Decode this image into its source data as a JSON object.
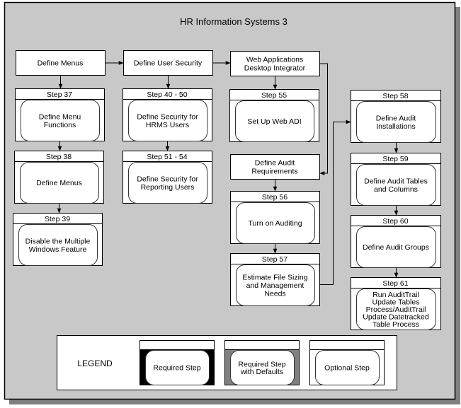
{
  "diagram": {
    "title": "HR Information Systems 3",
    "colors": {
      "background": "#c8c8c8",
      "shadow": "#808080",
      "box_fill": "#ffffff",
      "stroke": "#000000",
      "defaults_fill": "#808080"
    },
    "headers": [
      {
        "id": "define-menus",
        "lines": [
          "Define Menus"
        ]
      },
      {
        "id": "define-user-security",
        "lines": [
          "Define User Security"
        ]
      },
      {
        "id": "web-adi",
        "lines": [
          "Web Applications",
          "Desktop Integrator"
        ]
      },
      {
        "id": "define-audit-requirements",
        "lines": [
          "Define Audit",
          "Requirements"
        ]
      }
    ],
    "steps": [
      {
        "id": "step-37",
        "step": "Step 37",
        "lines": [
          "Define Menu",
          "Functions"
        ],
        "type": "optional"
      },
      {
        "id": "step-38",
        "step": "Step 38",
        "lines": [
          "Define Menus"
        ],
        "type": "optional"
      },
      {
        "id": "step-39",
        "step": "Step 39",
        "lines": [
          "Disable the Multiple",
          "Windows Feature"
        ],
        "type": "optional"
      },
      {
        "id": "step-40-50",
        "step": "Step 40 - 50",
        "lines": [
          "Define Security for",
          "HRMS Users"
        ],
        "type": "optional"
      },
      {
        "id": "step-51-54",
        "step": "Step 51 - 54",
        "lines": [
          "Define Security for",
          "Reporting Users"
        ],
        "type": "optional"
      },
      {
        "id": "step-55",
        "step": "Step 55",
        "lines": [
          "Set Up Web ADI"
        ],
        "type": "optional"
      },
      {
        "id": "step-56",
        "step": "Step 56",
        "lines": [
          "Turn on Auditing"
        ],
        "type": "optional"
      },
      {
        "id": "step-57",
        "step": "Step 57",
        "lines": [
          "Estimate File Sizing",
          "and Management",
          "Needs"
        ],
        "type": "optional"
      },
      {
        "id": "step-58",
        "step": "Step 58",
        "lines": [
          "Define Audit",
          "Installations"
        ],
        "type": "optional"
      },
      {
        "id": "step-59",
        "step": "Step 59",
        "lines": [
          "Define Audit Tables",
          "and Columns"
        ],
        "type": "optional"
      },
      {
        "id": "step-60",
        "step": "Step 60",
        "lines": [
          "Define Audit Groups"
        ],
        "type": "optional"
      },
      {
        "id": "step-61",
        "step": "Step 61",
        "lines": [
          "Run AuditTrail",
          "Update Tables",
          "Process/AuditTrail",
          "Update Datetracked",
          "Table Process"
        ],
        "type": "optional"
      }
    ],
    "edges": [
      {
        "from": "define-menus",
        "to": "define-user-security"
      },
      {
        "from": "define-user-security",
        "to": "web-adi"
      },
      {
        "from": "define-menus",
        "to": "step-37"
      },
      {
        "from": "step-37",
        "to": "step-38"
      },
      {
        "from": "step-38",
        "to": "step-39"
      },
      {
        "from": "define-user-security",
        "to": "step-40-50"
      },
      {
        "from": "step-40-50",
        "to": "step-51-54"
      },
      {
        "from": "web-adi",
        "to": "step-55"
      },
      {
        "from": "web-adi",
        "to": "define-audit-requirements"
      },
      {
        "from": "define-audit-requirements",
        "to": "step-56"
      },
      {
        "from": "step-56",
        "to": "step-57"
      },
      {
        "from": "step-57",
        "to": "step-58"
      },
      {
        "from": "step-58",
        "to": "step-59"
      },
      {
        "from": "step-59",
        "to": "step-60"
      },
      {
        "from": "step-60",
        "to": "step-61"
      }
    ],
    "legend": {
      "title": "LEGEND",
      "items": [
        {
          "type": "required",
          "lines": [
            "Required Step"
          ]
        },
        {
          "type": "defaults",
          "lines": [
            "Required Step",
            "with Defaults"
          ]
        },
        {
          "type": "optional",
          "lines": [
            "Optional Step"
          ]
        }
      ]
    }
  }
}
